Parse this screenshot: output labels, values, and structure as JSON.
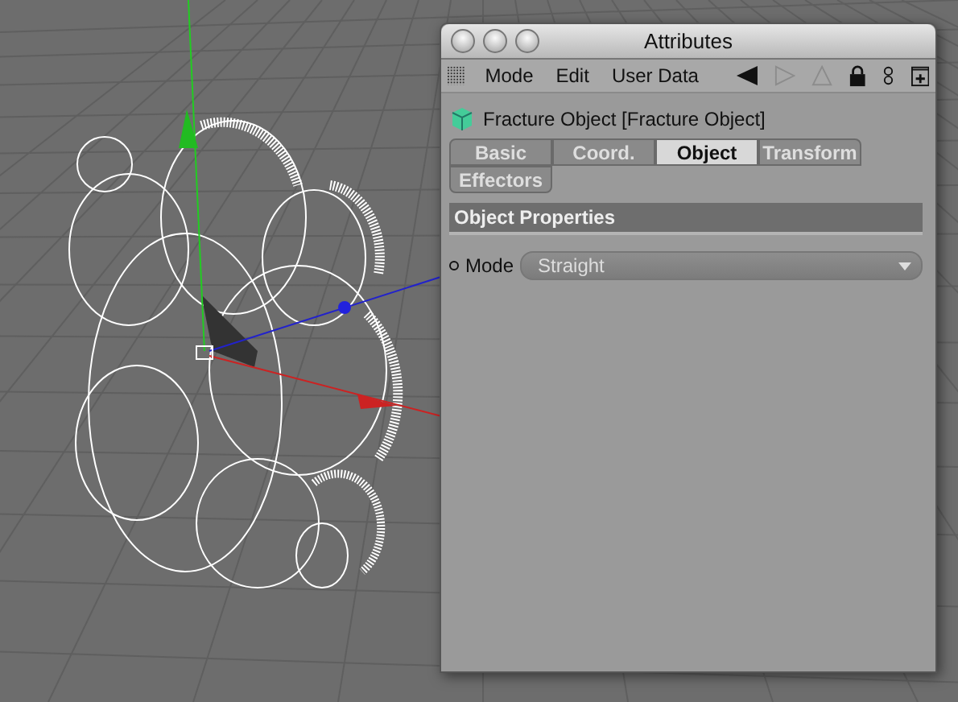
{
  "window": {
    "title": "Attributes"
  },
  "menu": [
    "Mode",
    "Edit",
    "User Data"
  ],
  "object_title": "Fracture Object [Fracture Object]",
  "tabs": [
    {
      "label": "Basic",
      "selected": false
    },
    {
      "label": "Coord.",
      "selected": false
    },
    {
      "label": "Object",
      "selected": true
    },
    {
      "label": "Transform",
      "selected": false
    },
    {
      "label": "Effectors",
      "selected": false
    }
  ],
  "section": {
    "title": "Object Properties"
  },
  "fields": [
    {
      "label": "Mode",
      "value": "Straight"
    }
  ]
}
